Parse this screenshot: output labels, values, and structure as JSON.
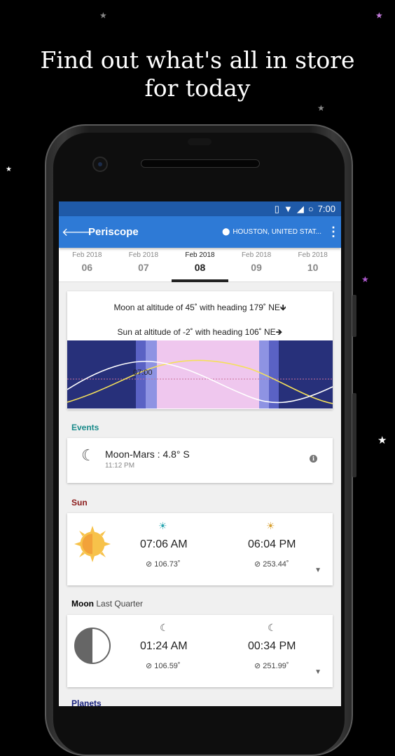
{
  "promo": {
    "headline_line1": "Find out what's all in store",
    "headline_line2": "for today"
  },
  "status_bar": {
    "time": "7:00",
    "icons": [
      "vibrate-icon",
      "wifi-icon",
      "lte-signal-icon",
      "battery-ring-icon"
    ]
  },
  "app_bar": {
    "back_icon": "arrow-left-icon",
    "title": "Periscope",
    "location": "HOUSTON, UNITED STAT...",
    "location_icon": "location-pin-icon",
    "menu_icon": "more-vert-icon",
    "color": "#2e7ad6"
  },
  "dates": [
    {
      "month": "Feb 2018",
      "day": "06",
      "active": false
    },
    {
      "month": "Feb 2018",
      "day": "07",
      "active": false
    },
    {
      "month": "Feb 2018",
      "day": "08",
      "active": true
    },
    {
      "month": "Feb 2018",
      "day": "09",
      "active": false
    },
    {
      "month": "Feb 2018",
      "day": "10",
      "active": false
    }
  ],
  "altitude": {
    "moon_line": "Moon at altitude of 45˚ with heading 179˚ NE🡻",
    "sun_line": "Sun at altitude of -2˚ with heading 106˚ NE🡺",
    "chart_time_label": "07:00"
  },
  "events": {
    "label": "Events",
    "label_color": "#1a8a8a",
    "item": {
      "icon": "crescent-moon-icon",
      "title": "Moon-Mars : 4.8° S",
      "time": "11:12 PM"
    }
  },
  "sun": {
    "label": "Sun",
    "label_color": "#8b1a1a",
    "rise_icon": "sunrise-icon",
    "rise_time": "07:06 AM",
    "rise_azimuth": "106.73˚",
    "set_icon": "sunset-icon",
    "set_time": "06:04 PM",
    "set_azimuth": "253.44˚"
  },
  "moon": {
    "label": "Moon",
    "phase": "Last Quarter",
    "rise_icon": "moonrise-icon",
    "rise_time": "01:24 AM",
    "rise_azimuth": "106.59˚",
    "set_icon": "moonset-icon",
    "set_time": "00:34 PM",
    "set_azimuth": "251.99˚"
  },
  "planets": {
    "label": "Planets"
  }
}
